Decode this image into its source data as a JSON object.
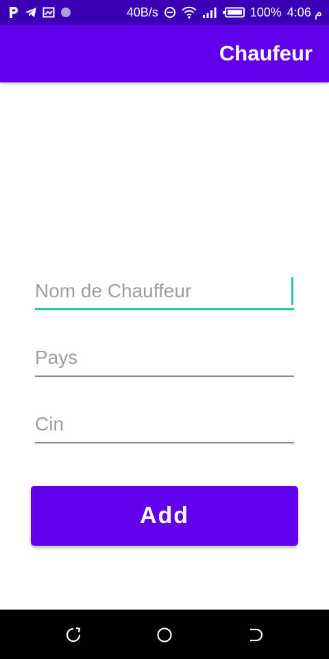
{
  "status_bar": {
    "left_icons": [
      "p-app-icon",
      "telegram-icon",
      "cast-icon",
      "circle-notification-icon"
    ],
    "speed": "40B/s",
    "battery": "100%",
    "time": "4:06 م"
  },
  "app_bar": {
    "title": "Chaufeur"
  },
  "form": {
    "nom_placeholder": "Nom de Chauffeur",
    "nom_value": "",
    "pays_placeholder": "Pays",
    "pays_value": "",
    "cin_placeholder": "Cin",
    "cin_value": "",
    "add_label": "Add"
  },
  "colors": {
    "status_bar": "#3a00b8",
    "primary": "#6200ea",
    "focus_accent": "#1fc4b7",
    "nav_bar": "#000000"
  },
  "nav_bar": {
    "icons": [
      "recents-icon",
      "home-icon",
      "back-icon"
    ]
  }
}
